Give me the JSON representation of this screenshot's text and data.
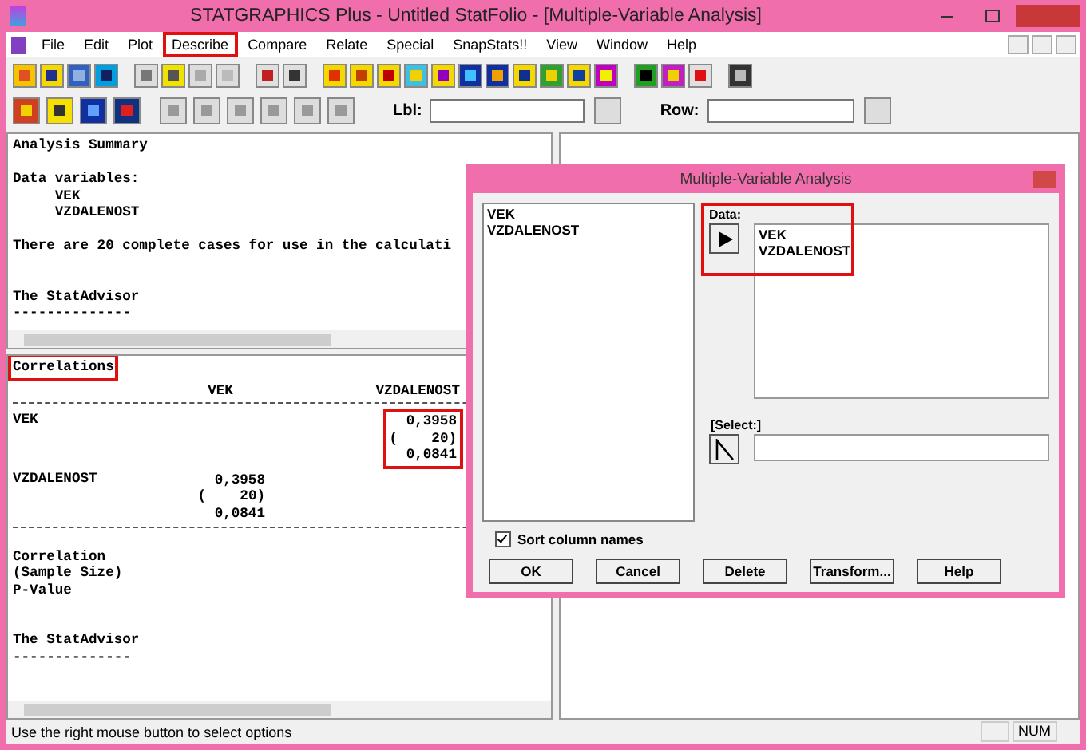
{
  "window": {
    "title": "STATGRAPHICS Plus - Untitled StatFolio - [Multiple-Variable Analysis]"
  },
  "menu": [
    {
      "label": "File",
      "highlighted": false
    },
    {
      "label": "Edit",
      "highlighted": false
    },
    {
      "label": "Plot",
      "highlighted": false
    },
    {
      "label": "Describe",
      "highlighted": true
    },
    {
      "label": "Compare",
      "highlighted": false
    },
    {
      "label": "Relate",
      "highlighted": false
    },
    {
      "label": "Special",
      "highlighted": false
    },
    {
      "label": "SnapStats!!",
      "highlighted": false
    },
    {
      "label": "View",
      "highlighted": false
    },
    {
      "label": "Window",
      "highlighted": false
    },
    {
      "label": "Help",
      "highlighted": false
    }
  ],
  "toolbar2": {
    "lbl_label": "Lbl:",
    "row_label": "Row:"
  },
  "summary_pane": {
    "blocks": [
      [
        "Analysis Summary"
      ],
      [
        "Data variables:",
        "     VEK",
        "     VZDALENOST"
      ],
      [
        "There are 20 complete cases for use in the calculati"
      ],
      [
        "The StatAdvisor",
        "--------------"
      ]
    ]
  },
  "correlations_pane": {
    "title": "Correlations",
    "title_highlighted": true,
    "columns": [
      "VEK",
      "VZDALENOST"
    ],
    "rows": [
      {
        "label": "VEK",
        "cells": [
          {
            "kind": "empty"
          },
          {
            "kind": "value",
            "text": "0,3958\n(    20)\n0,0841",
            "highlighted": true
          }
        ]
      },
      {
        "label": "VZDALENOST",
        "cells": [
          {
            "kind": "value",
            "text": "0,3958\n(    20)\n0,0841",
            "highlighted": false
          },
          {
            "kind": "empty"
          }
        ]
      }
    ],
    "legend": [
      "Correlation",
      "(Sample Size)",
      "P-Value"
    ],
    "advisor_title": "The StatAdvisor",
    "advisor_rule": "--------------"
  },
  "dialog": {
    "title": "Multiple-Variable Analysis",
    "variables": [
      "VEK",
      "VZDALENOST"
    ],
    "data_label": "Data:",
    "data_values": [
      "VEK",
      "VZDALENOST"
    ],
    "data_highlighted": true,
    "select_label": "[Select:]",
    "sort_label": "Sort column names",
    "sort_checked": true,
    "buttons": [
      "OK",
      "Cancel",
      "Delete",
      "Transform...",
      "Help"
    ]
  },
  "status_bar": {
    "text": "Use the right mouse button to select options",
    "indicator": "NUM"
  }
}
